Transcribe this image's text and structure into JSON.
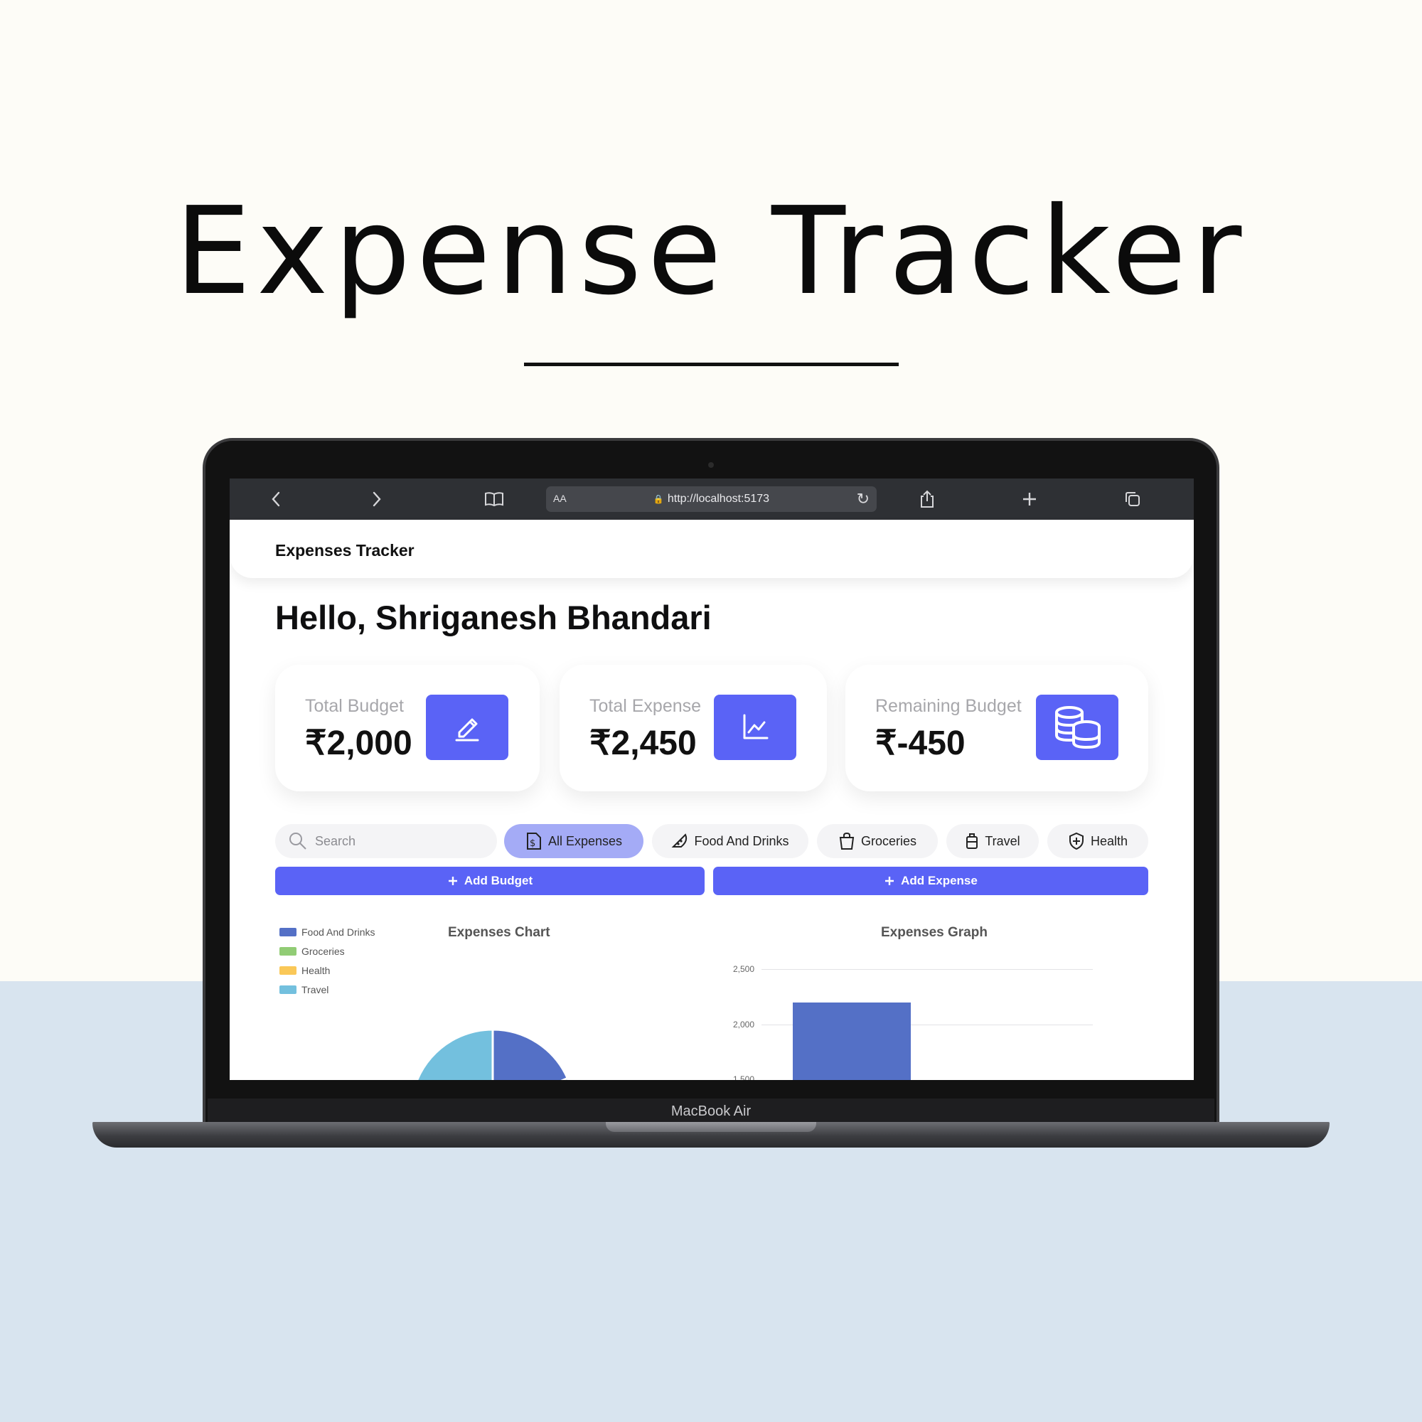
{
  "hero": {
    "title": "Expense Tracker"
  },
  "laptop": {
    "model_label": "MacBook Air"
  },
  "browser": {
    "text_size_label": "AA",
    "url": "http://localhost:5173",
    "icons": [
      "chevron-left-icon",
      "chevron-right-icon",
      "book-icon",
      "lock-icon",
      "reload-icon",
      "share-icon",
      "plus-icon",
      "tabs-icon"
    ]
  },
  "app": {
    "title": "Expenses Tracker",
    "greeting": "Hello, Shriganesh Bhandari",
    "cards": [
      {
        "label": "Total Budget",
        "value": "₹2,000",
        "icon": "pencil-icon"
      },
      {
        "label": "Total Expense",
        "value": "₹2,450",
        "icon": "line-chart-icon"
      },
      {
        "label": "Remaining Budget",
        "value": "₹-450",
        "icon": "coins-icon"
      }
    ],
    "search": {
      "placeholder": "Search"
    },
    "filters": [
      {
        "label": "All Expenses",
        "icon": "dollar-file-icon",
        "active": true
      },
      {
        "label": "Food And Drinks",
        "icon": "pizza-icon",
        "active": false
      },
      {
        "label": "Groceries",
        "icon": "shopping-bag-icon",
        "active": false
      },
      {
        "label": "Travel",
        "icon": "luggage-icon",
        "active": false
      },
      {
        "label": "Health",
        "icon": "health-shield-icon",
        "active": false
      }
    ],
    "actions": {
      "add_budget": "Add Budget",
      "add_expense": "Add Expense"
    },
    "colors": {
      "accent": "#5a63f6",
      "active_chip": "#a4abf6"
    }
  },
  "chart_data": [
    {
      "type": "pie",
      "title": "Expenses Chart",
      "legend_position": "top-left",
      "categories": [
        "Food And Drinks",
        "Groceries",
        "Health",
        "Travel"
      ],
      "colors": [
        "#5470c6",
        "#91cc75",
        "#fac858",
        "#73c0de"
      ],
      "values": [
        450,
        0,
        0,
        2000
      ]
    },
    {
      "type": "bar",
      "title": "Expenses Graph",
      "y_ticks": [
        "2,500",
        "2,000",
        "1,500"
      ],
      "ylim": [
        1500,
        2500
      ],
      "values": [
        2200
      ],
      "color": "#5470c6"
    }
  ]
}
